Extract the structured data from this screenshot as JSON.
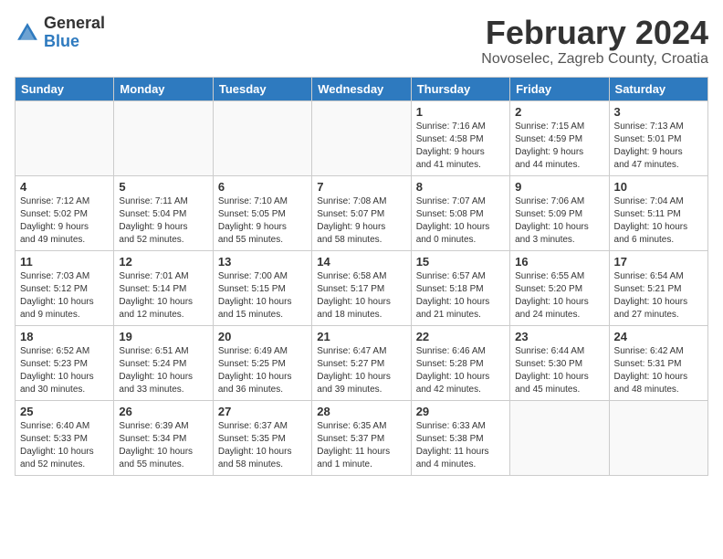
{
  "header": {
    "logo_general": "General",
    "logo_blue": "Blue",
    "month": "February 2024",
    "location": "Novoselec, Zagreb County, Croatia"
  },
  "weekdays": [
    "Sunday",
    "Monday",
    "Tuesday",
    "Wednesday",
    "Thursday",
    "Friday",
    "Saturday"
  ],
  "weeks": [
    [
      {
        "day": "",
        "info": ""
      },
      {
        "day": "",
        "info": ""
      },
      {
        "day": "",
        "info": ""
      },
      {
        "day": "",
        "info": ""
      },
      {
        "day": "1",
        "info": "Sunrise: 7:16 AM\nSunset: 4:58 PM\nDaylight: 9 hours\nand 41 minutes."
      },
      {
        "day": "2",
        "info": "Sunrise: 7:15 AM\nSunset: 4:59 PM\nDaylight: 9 hours\nand 44 minutes."
      },
      {
        "day": "3",
        "info": "Sunrise: 7:13 AM\nSunset: 5:01 PM\nDaylight: 9 hours\nand 47 minutes."
      }
    ],
    [
      {
        "day": "4",
        "info": "Sunrise: 7:12 AM\nSunset: 5:02 PM\nDaylight: 9 hours\nand 49 minutes."
      },
      {
        "day": "5",
        "info": "Sunrise: 7:11 AM\nSunset: 5:04 PM\nDaylight: 9 hours\nand 52 minutes."
      },
      {
        "day": "6",
        "info": "Sunrise: 7:10 AM\nSunset: 5:05 PM\nDaylight: 9 hours\nand 55 minutes."
      },
      {
        "day": "7",
        "info": "Sunrise: 7:08 AM\nSunset: 5:07 PM\nDaylight: 9 hours\nand 58 minutes."
      },
      {
        "day": "8",
        "info": "Sunrise: 7:07 AM\nSunset: 5:08 PM\nDaylight: 10 hours\nand 0 minutes."
      },
      {
        "day": "9",
        "info": "Sunrise: 7:06 AM\nSunset: 5:09 PM\nDaylight: 10 hours\nand 3 minutes."
      },
      {
        "day": "10",
        "info": "Sunrise: 7:04 AM\nSunset: 5:11 PM\nDaylight: 10 hours\nand 6 minutes."
      }
    ],
    [
      {
        "day": "11",
        "info": "Sunrise: 7:03 AM\nSunset: 5:12 PM\nDaylight: 10 hours\nand 9 minutes."
      },
      {
        "day": "12",
        "info": "Sunrise: 7:01 AM\nSunset: 5:14 PM\nDaylight: 10 hours\nand 12 minutes."
      },
      {
        "day": "13",
        "info": "Sunrise: 7:00 AM\nSunset: 5:15 PM\nDaylight: 10 hours\nand 15 minutes."
      },
      {
        "day": "14",
        "info": "Sunrise: 6:58 AM\nSunset: 5:17 PM\nDaylight: 10 hours\nand 18 minutes."
      },
      {
        "day": "15",
        "info": "Sunrise: 6:57 AM\nSunset: 5:18 PM\nDaylight: 10 hours\nand 21 minutes."
      },
      {
        "day": "16",
        "info": "Sunrise: 6:55 AM\nSunset: 5:20 PM\nDaylight: 10 hours\nand 24 minutes."
      },
      {
        "day": "17",
        "info": "Sunrise: 6:54 AM\nSunset: 5:21 PM\nDaylight: 10 hours\nand 27 minutes."
      }
    ],
    [
      {
        "day": "18",
        "info": "Sunrise: 6:52 AM\nSunset: 5:23 PM\nDaylight: 10 hours\nand 30 minutes."
      },
      {
        "day": "19",
        "info": "Sunrise: 6:51 AM\nSunset: 5:24 PM\nDaylight: 10 hours\nand 33 minutes."
      },
      {
        "day": "20",
        "info": "Sunrise: 6:49 AM\nSunset: 5:25 PM\nDaylight: 10 hours\nand 36 minutes."
      },
      {
        "day": "21",
        "info": "Sunrise: 6:47 AM\nSunset: 5:27 PM\nDaylight: 10 hours\nand 39 minutes."
      },
      {
        "day": "22",
        "info": "Sunrise: 6:46 AM\nSunset: 5:28 PM\nDaylight: 10 hours\nand 42 minutes."
      },
      {
        "day": "23",
        "info": "Sunrise: 6:44 AM\nSunset: 5:30 PM\nDaylight: 10 hours\nand 45 minutes."
      },
      {
        "day": "24",
        "info": "Sunrise: 6:42 AM\nSunset: 5:31 PM\nDaylight: 10 hours\nand 48 minutes."
      }
    ],
    [
      {
        "day": "25",
        "info": "Sunrise: 6:40 AM\nSunset: 5:33 PM\nDaylight: 10 hours\nand 52 minutes."
      },
      {
        "day": "26",
        "info": "Sunrise: 6:39 AM\nSunset: 5:34 PM\nDaylight: 10 hours\nand 55 minutes."
      },
      {
        "day": "27",
        "info": "Sunrise: 6:37 AM\nSunset: 5:35 PM\nDaylight: 10 hours\nand 58 minutes."
      },
      {
        "day": "28",
        "info": "Sunrise: 6:35 AM\nSunset: 5:37 PM\nDaylight: 11 hours\nand 1 minute."
      },
      {
        "day": "29",
        "info": "Sunrise: 6:33 AM\nSunset: 5:38 PM\nDaylight: 11 hours\nand 4 minutes."
      },
      {
        "day": "",
        "info": ""
      },
      {
        "day": "",
        "info": ""
      }
    ]
  ]
}
